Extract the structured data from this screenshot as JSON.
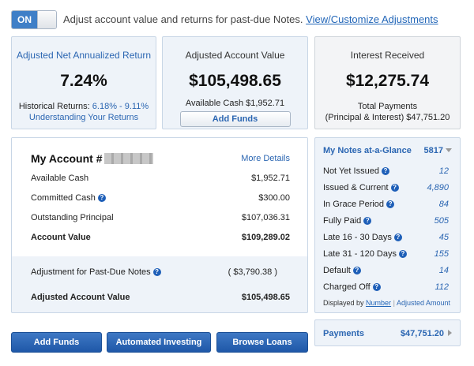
{
  "toggle": {
    "label": "ON"
  },
  "adjust": {
    "text": "Adjust account value and returns for past-due Notes.",
    "link": "View/Customize Adjustments"
  },
  "naar": {
    "title": "Adjusted Net Annualized Return",
    "value": "7.24%",
    "hist_label": "Historical Returns:",
    "hist_range": "6.18% - 9.11%",
    "link": "Understanding Your Returns"
  },
  "aav": {
    "title": "Adjusted Account Value",
    "value": "$105,498.65",
    "cash": "Available Cash $1,952.71",
    "button": "Add Funds"
  },
  "interest": {
    "title": "Interest Received",
    "value": "$12,275.74",
    "line1": "Total Payments",
    "line2": "(Principal & Interest) $47,751.20"
  },
  "account": {
    "title": "My Account #",
    "more": "More Details",
    "rows": [
      {
        "label": "Available Cash",
        "value": "$1,952.71"
      },
      {
        "label": "Committed Cash",
        "value": "$300.00"
      },
      {
        "label": "Outstanding Principal",
        "value": "$107,036.31"
      },
      {
        "label": "Account Value",
        "value": "$109,289.02"
      }
    ],
    "adjust_label": "Adjustment for Past-Due Notes",
    "adjust_value": "( $3,790.38 )",
    "adjusted_label": "Adjusted Account Value",
    "adjusted_value": "$105,498.65"
  },
  "glance": {
    "title": "My Notes at-a-Glance",
    "count": "5817",
    "rows": [
      {
        "label": "Not Yet Issued",
        "value": "12"
      },
      {
        "label": "Issued & Current",
        "value": "4,890"
      },
      {
        "label": "In Grace Period",
        "value": "84"
      },
      {
        "label": "Fully Paid",
        "value": "505"
      },
      {
        "label": "Late 16 - 30 Days",
        "value": "45"
      },
      {
        "label": "Late 31 - 120 Days",
        "value": "155"
      },
      {
        "label": "Default",
        "value": "14"
      },
      {
        "label": "Charged Off",
        "value": "112"
      }
    ],
    "displayed_by": "Displayed by",
    "by_number": "Number",
    "separator": "|",
    "by_amount": "Adjusted Amount"
  },
  "payments": {
    "label": "Payments",
    "value": "$47,751.20"
  },
  "buttons": {
    "add_funds": "Add Funds",
    "automated": "Automated Investing",
    "browse": "Browse Loans"
  },
  "colors": {
    "accent": "#2b66b2",
    "button": "#1f58a8",
    "panel": "#eef3f9"
  }
}
